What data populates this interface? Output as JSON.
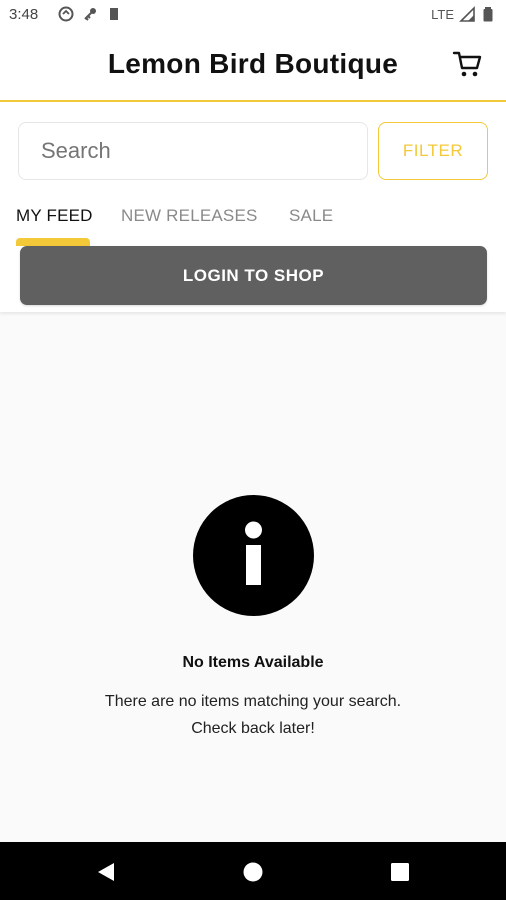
{
  "status_bar": {
    "time": "3:48",
    "network": "LTE"
  },
  "app_bar": {
    "title": "Lemon Bird Boutique",
    "cart_icon": "shopping-cart-icon"
  },
  "search": {
    "placeholder": "Search",
    "value": ""
  },
  "filter_button": {
    "label": "FILTER"
  },
  "tabs": [
    {
      "label": "MY FEED",
      "active": true
    },
    {
      "label": "NEW RELEASES",
      "active": false
    },
    {
      "label": "SALE",
      "active": false
    }
  ],
  "login_button": {
    "label": "LOGIN TO SHOP"
  },
  "empty_state": {
    "icon": "info-icon",
    "title": "No Items Available",
    "message_line1": "There are no items matching your search.",
    "message_line2": "Check back later!"
  },
  "colors": {
    "accent": "#f3c939",
    "button_bg": "#606060",
    "background": "#fafafa"
  }
}
